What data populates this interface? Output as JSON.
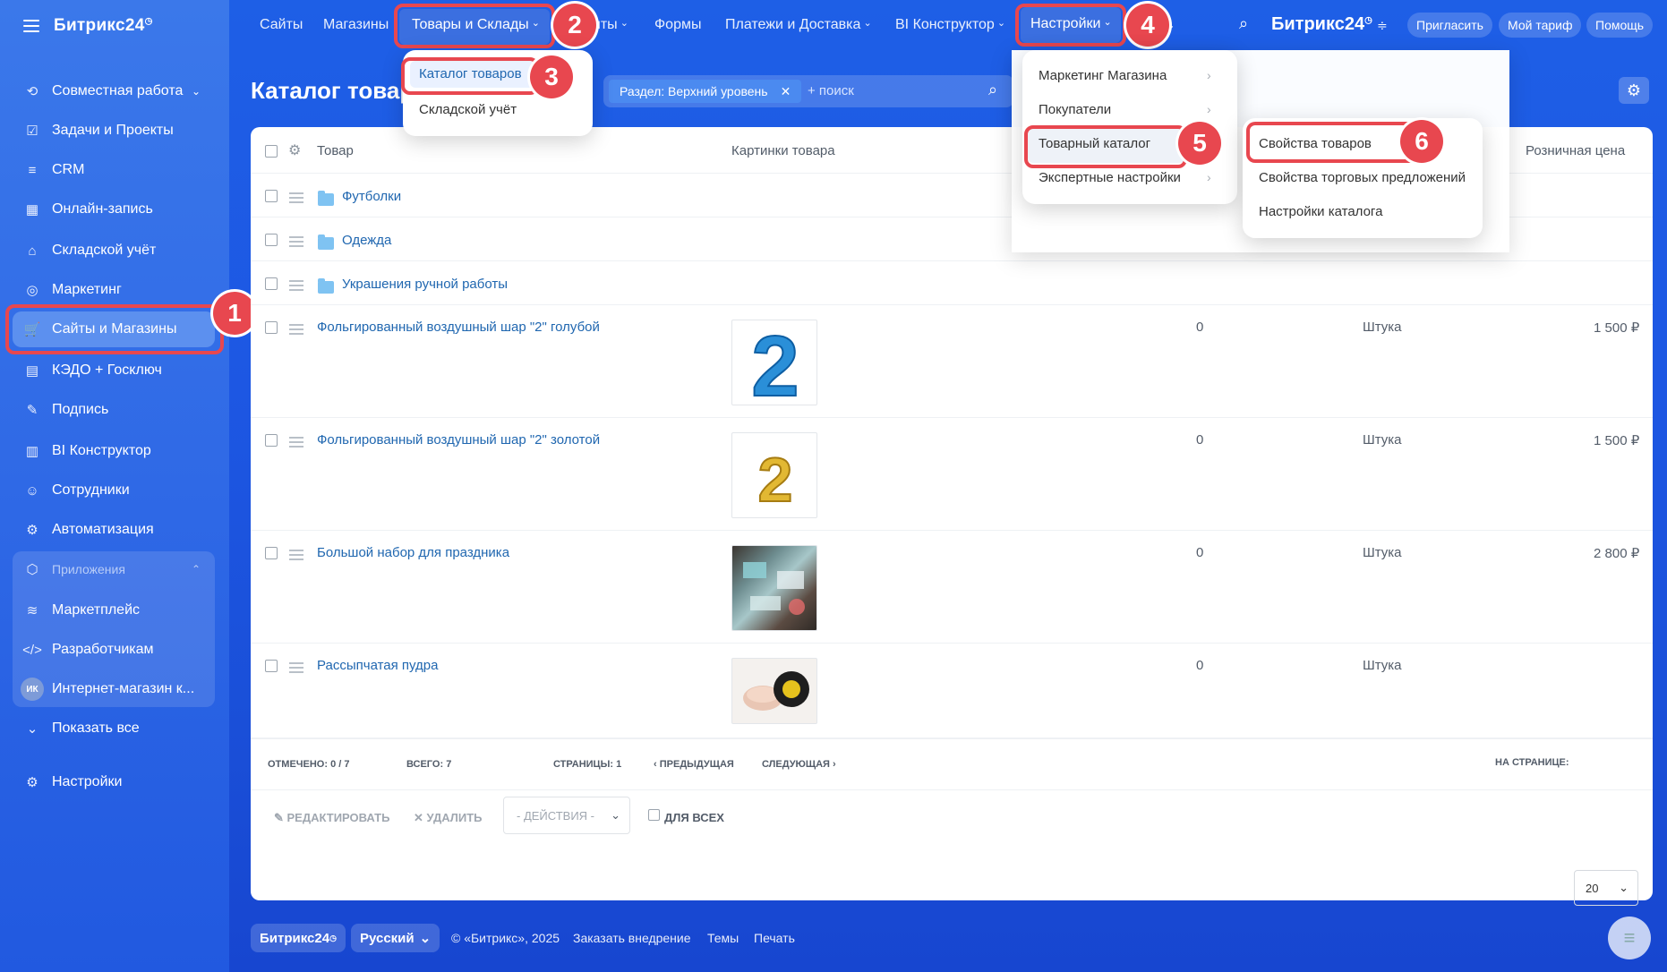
{
  "brand": {
    "logo": "Битрикс24"
  },
  "sidebar": {
    "items": [
      {
        "label": "Совместная работа"
      },
      {
        "label": "Задачи и Проекты"
      },
      {
        "label": "CRM"
      },
      {
        "label": "Онлайн-запись"
      },
      {
        "label": "Складской учёт"
      },
      {
        "label": "Маркетинг"
      },
      {
        "label": "Сайты и Магазины"
      },
      {
        "label": "КЭДО + Госключ"
      },
      {
        "label": "Подпись"
      },
      {
        "label": "BI Конструктор"
      },
      {
        "label": "Сотрудники"
      },
      {
        "label": "Автоматизация"
      }
    ],
    "apps_header": "Приложения",
    "apps": [
      {
        "label": "Маркетплейс"
      },
      {
        "label": "Разработчикам"
      },
      {
        "label": "Интернет-магазин к...",
        "avatar": "ИК"
      }
    ],
    "show_all": "Показать все",
    "settings": "Настройки"
  },
  "topnav": {
    "items": [
      "Сайты",
      "Магазины",
      "Товары и Склады",
      "нты",
      "Формы",
      "Платежи и Доставка",
      "BI Конструктор",
      "Настройки"
    ],
    "brand": "Битрикс24",
    "invite": "Пригласить",
    "tariff": "Мой тариф",
    "help": "Помощь"
  },
  "page": {
    "title": "Каталог товар",
    "filter_chip": "Раздел: Верхний уровень",
    "search_placeholder": "+ поиск"
  },
  "goods_menu": [
    "Каталог товаров",
    "Складской учёт"
  ],
  "settings_menu": [
    "Маркетинг Магазина",
    "Покупатели",
    "Товарный каталог",
    "Экспертные настройки"
  ],
  "catalog_menu": [
    "Свойства товаров",
    "Свойства торговых предложений",
    "Настройки каталога"
  ],
  "annotations": [
    "1",
    "2",
    "3",
    "4",
    "5",
    "6"
  ],
  "grid": {
    "headers": {
      "product": "Товар",
      "images": "Картинки товара",
      "price": "Розничная цена"
    },
    "folders": [
      "Футболки",
      "Одежда",
      "Украшения ручной работы"
    ],
    "rows": [
      {
        "name": "Фольгированный воздушный шар \"2\" голубой",
        "qty": "0",
        "unit": "Штука",
        "price": "1 500 ₽"
      },
      {
        "name": "Фольгированный воздушный шар \"2\" золотой",
        "qty": "0",
        "unit": "Штука",
        "price": "1 500 ₽"
      },
      {
        "name": "Большой набор для праздника",
        "qty": "0",
        "unit": "Штука",
        "price": "2 800 ₽"
      },
      {
        "name": "Рассыпчатая пудра",
        "qty": "0",
        "unit": "Штука",
        "price": ""
      }
    ],
    "footer": {
      "marked_label": "Отмечено:",
      "marked": "0 / 7",
      "total_label": "Всего:",
      "total": "7",
      "pages_label": "Страницы:",
      "pages": "1",
      "prev": "Предыдущая",
      "next": "Следующая",
      "per_page_label": "На странице:",
      "per_page": "20"
    },
    "actions": {
      "edit": "Редактировать",
      "delete": "Удалить",
      "actions": "- действия -",
      "for_all": "Для всех"
    }
  },
  "footer": {
    "brand": "Битрикс24",
    "lang": "Русский",
    "copyright": "© «Битрикс», 2025",
    "order": "Заказать внедрение",
    "themes": "Темы",
    "print": "Печать"
  }
}
